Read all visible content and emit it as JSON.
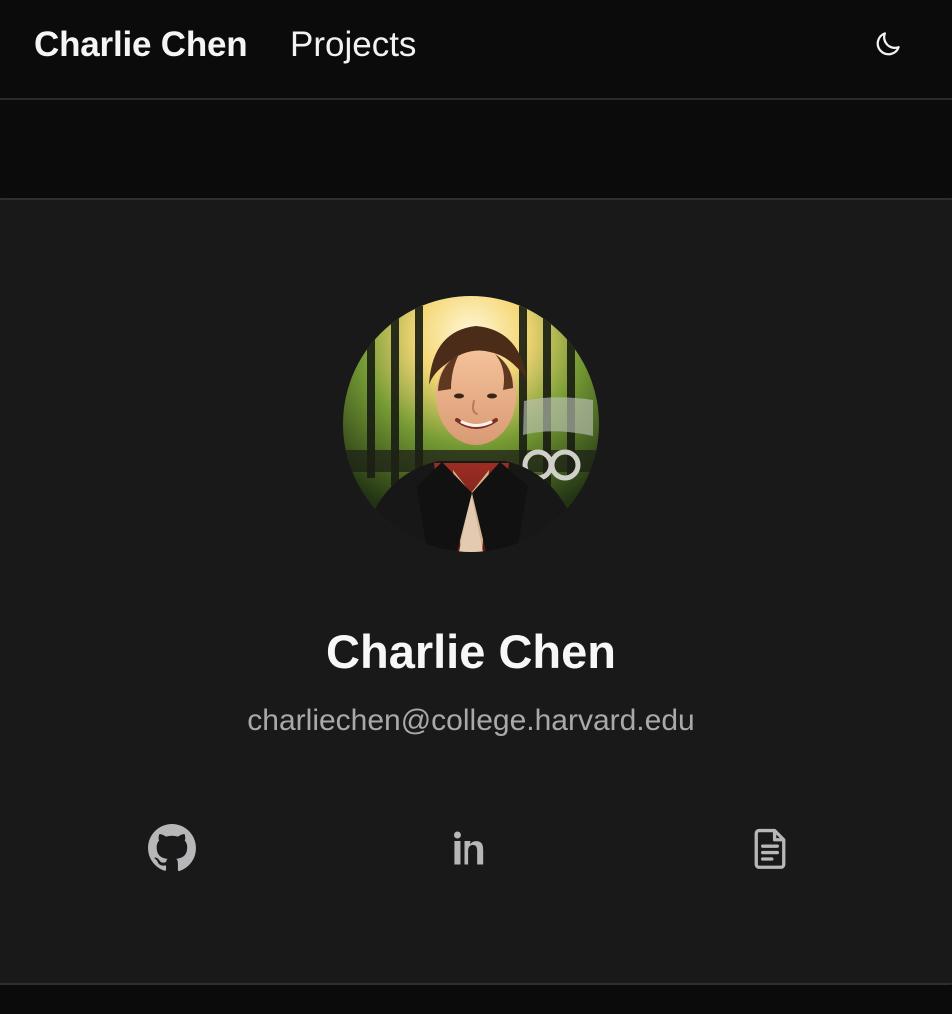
{
  "nav": {
    "brand": "Charlie Chen",
    "links": [
      {
        "label": "Projects"
      }
    ],
    "theme_toggle_icon": "moon-icon"
  },
  "profile": {
    "name": "Charlie Chen",
    "email": "charliechen@college.harvard.edu",
    "avatar_description_icon": "profile-photo"
  },
  "social": [
    {
      "icon": "github-icon"
    },
    {
      "icon": "linkedin-icon"
    },
    {
      "icon": "resume-document-icon"
    }
  ],
  "colors": {
    "background": "#0b0b0c",
    "card": "#19191a",
    "text": "#f2f2f2",
    "muted": "#a9a9ab",
    "icon": "#b7b7b9",
    "border": "#2f2f30"
  }
}
